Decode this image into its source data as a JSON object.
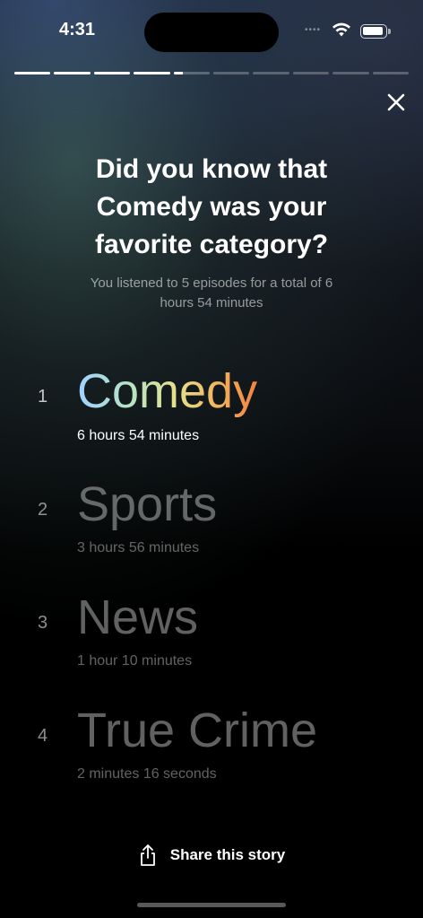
{
  "status_bar": {
    "time": "4:31"
  },
  "progress": {
    "total_segments": 10,
    "completed_segments": 4,
    "current_segment_fraction": 0.25
  },
  "headline": "Did you know that Comedy was your favorite category?",
  "subline": "You listened to 5 episodes for a total of 6 hours 54 minutes",
  "categories": [
    {
      "rank": "1",
      "name": "Comedy",
      "duration": "6 hours 54 minutes"
    },
    {
      "rank": "2",
      "name": "Sports",
      "duration": "3 hours 56 minutes"
    },
    {
      "rank": "3",
      "name": "News",
      "duration": "1 hour 10 minutes"
    },
    {
      "rank": "4",
      "name": "True Crime",
      "duration": "2 minutes 16 seconds"
    }
  ],
  "share": {
    "label": "Share this story",
    "icon": "share-icon"
  },
  "close": {
    "icon": "close-icon"
  },
  "colors": {
    "gradient": [
      "#9fd2ff",
      "#b7e3c2",
      "#e5e08c",
      "#f3b05b",
      "#f0833e"
    ]
  }
}
